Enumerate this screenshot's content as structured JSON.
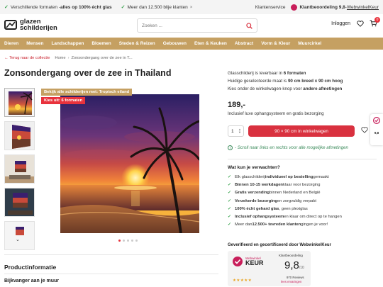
{
  "topbar": {
    "usp1_pre": "Verschillende formaten - ",
    "usp1_bold": "alles op 100% écht glas",
    "usp2": "Meer dan 12.500 blije klanten",
    "service": "Klantenservice",
    "rating_label": "Klantbeoordeling 9,8",
    "rating_sep": " - ",
    "rating_link": "WebwinkelKeur"
  },
  "header": {
    "logo_line1": "glazen",
    "logo_line2": "schilderijen",
    "search_placeholder": "Zoeken ...",
    "login": "Inloggen",
    "cart_count": "0"
  },
  "nav": {
    "items": [
      "Dieren",
      "Mensen",
      "Landschappen",
      "Bloemen",
      "Steden & Reizen",
      "Gebouwen",
      "Eten & Keuken",
      "Abstract",
      "Vorm & Kleur",
      "Muurcirkel"
    ]
  },
  "breadcrumb": {
    "back": "Terug naar de collectie",
    "home": "Home",
    "current": "Zonsondergang over de zee in T..."
  },
  "product": {
    "title": "Zonsondergang over de zee in Thailand",
    "chip_collection": "Bekijk alle schilderijen met: Tropisch eiland",
    "chip_formats": "Kies uit: 6 formaten",
    "info_heading": "Productinformatie",
    "info_sub": "Bijkvanger aan je muur"
  },
  "buybox": {
    "line1_pre": "Glasschilderij is leverbaar in ",
    "line1_bold": "6 formaten",
    "line2_pre": "Huidige geselecteerde maat is ",
    "line2_bold": "90 cm breed x 90 cm hoog",
    "line3_pre": "Kies onder de winkelwagen-knop voor ",
    "line3_bold": "andere afmetingen",
    "price": "189,-",
    "price_note": "Inclusief luxe ophangsysteem en gratis bezorging",
    "quantity": "1",
    "cta": "90 × 90 cm in winkelwagen",
    "scroll_note": "- Scroll naar links en rechts voor alle mogelijke afmetingen"
  },
  "expect": {
    "heading": "Wat kun je verwachten?",
    "items": [
      {
        "pre": "Elk glasschilderij ",
        "bold": "individueel op bestelling",
        "post": " gemaakt"
      },
      {
        "pre": "",
        "bold": "Binnen 10-15 werkdagen",
        "post": " klaar voor bezorging"
      },
      {
        "pre": "",
        "bold": "Gratis verzending",
        "post": " binnen Nederland en België"
      },
      {
        "pre": "",
        "bold": "Verzekerde bezorging",
        "post": " en zorgvuldig verpakt"
      },
      {
        "pre": "",
        "bold": "100% écht gehard glas",
        "post": ", geen plexiglas"
      },
      {
        "pre": "",
        "bold": "Inclusief ophangsysteem",
        "post": " en klaar om direct op te hangen"
      },
      {
        "pre": "Meer dan ",
        "bold": "12.500+ tevreden klanten",
        "post": " gingen je voor!"
      }
    ]
  },
  "certificate": {
    "heading": "Geverifieerd en gecertificeerd door WebwinkelKeur",
    "brand_small": "Webwinkel",
    "brand_big": "KEUR",
    "rating_label": "Klantbeoordeling",
    "score": "9,8",
    "score_max": "/10",
    "reviews": "970 Reviews",
    "reviews_link": "lees ervaringen",
    "stars": "★★★★★"
  },
  "side_widget": {
    "score": "9,8"
  },
  "colors": {
    "nav_bg": "#c5a062",
    "cta": "#d9313f",
    "badge_red": "#e8323c",
    "keur_pink": "#c81e5a",
    "check_green": "#3aa34f"
  }
}
